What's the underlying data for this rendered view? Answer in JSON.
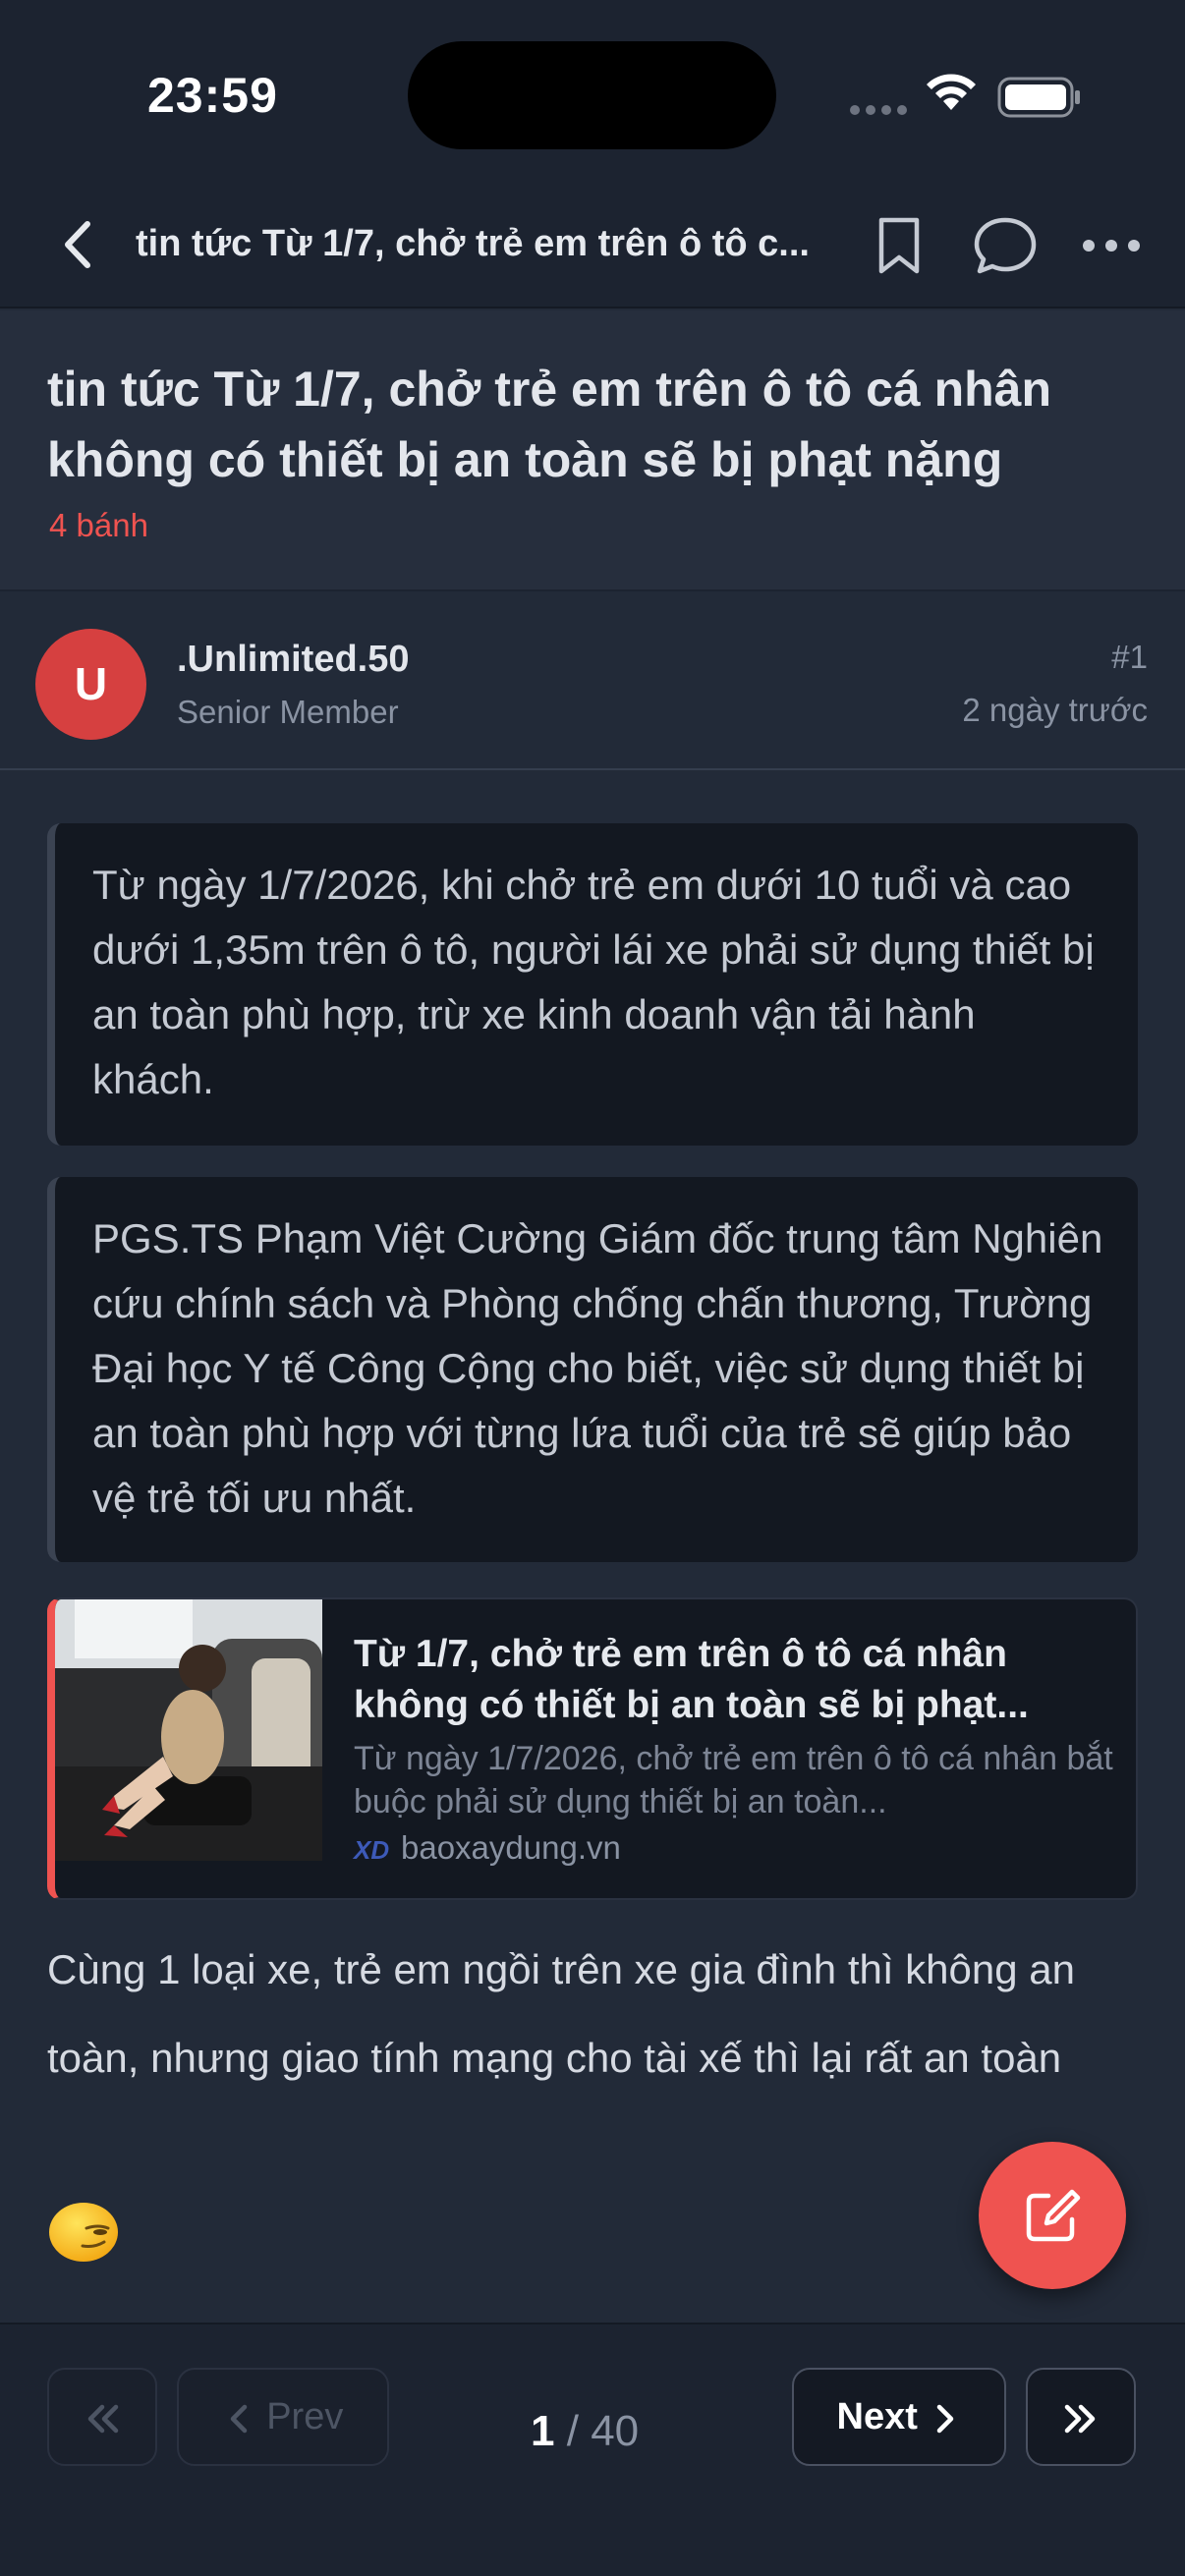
{
  "status_bar": {
    "time": "23:59"
  },
  "nav": {
    "title": "tin tức Từ 1/7, chở trẻ em trên ô tô c..."
  },
  "thread": {
    "title": "tin tức Từ 1/7, chở trẻ em trên ô tô cá nhân không có thiết bị an toàn sẽ bị phạt nặng",
    "tag": "4 bánh"
  },
  "post": {
    "author": {
      "avatar_letter": "U",
      "name": ".Unlimited.50",
      "role": "Senior Member"
    },
    "number": "#1",
    "time": "2 ngày trước",
    "quotes": [
      "Từ ngày 1/7/2026, khi chở trẻ em dưới 10 tuổi và cao dưới 1,35m trên ô tô, người lái xe phải sử dụng thiết bị an toàn phù hợp, trừ xe kinh doanh vận tải hành khách.",
      "PGS.TS Phạm Việt Cường Giám đốc trung tâm Nghiên cứu chính sách và Phòng chống chấn thương, Trường Đại học Y tế Công Cộng cho biết, việc sử dụng thiết bị an toàn phù hợp với từng lứa tuổi của trẻ sẽ giúp bảo vệ trẻ tối ưu nhất."
    ],
    "link_card": {
      "title": "Từ 1/7, chở trẻ em trên ô tô cá nhân không có thiết bị an toàn sẽ bị phạt...",
      "description": "Từ ngày 1/7/2026, chở trẻ em trên ô tô cá nhân bắt buộc phải sử dụng thiết bị an toàn...",
      "source_logo": "XD",
      "source": "baoxaydung.vn"
    },
    "body": "Cùng 1 loại xe, trẻ em ngồi trên xe gia đình thì không an toàn, nhưng giao tính mạng cho tài xế thì lại rất an toàn",
    "emoji": "smirk-face"
  },
  "pagination": {
    "prev_label": "Prev",
    "next_label": "Next",
    "current_page": "1",
    "separator": "/",
    "total_pages": "40"
  },
  "colors": {
    "background": "#222a38",
    "bar": "#1c2330",
    "accent": "#ef5350",
    "avatar": "#d64040"
  }
}
